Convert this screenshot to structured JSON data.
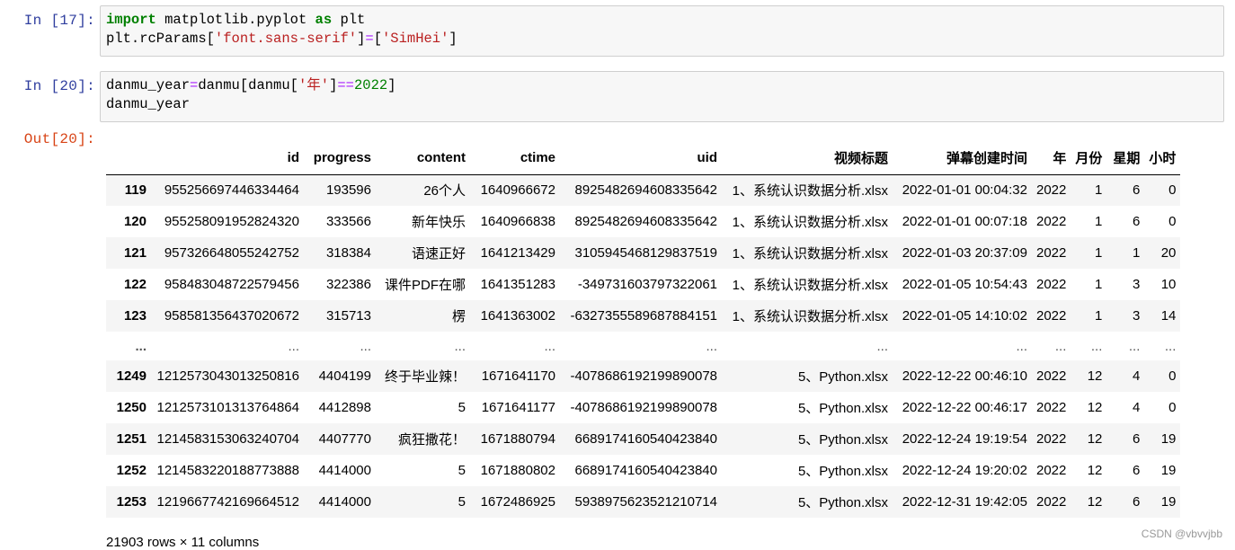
{
  "cells": [
    {
      "prompt": "In  [17]:",
      "lines": [
        [
          {
            "t": "import",
            "c": "kw"
          },
          {
            "t": " matplotlib.pyplot ",
            "c": ""
          },
          {
            "t": "as",
            "c": "kw"
          },
          {
            "t": " plt",
            "c": ""
          }
        ],
        [
          {
            "t": "plt.rcParams[",
            "c": ""
          },
          {
            "t": "'font.sans-serif'",
            "c": "str"
          },
          {
            "t": "]",
            "c": ""
          },
          {
            "t": "=",
            "c": "op"
          },
          {
            "t": "[",
            "c": ""
          },
          {
            "t": "'SimHei'",
            "c": "str"
          },
          {
            "t": "]",
            "c": ""
          }
        ]
      ]
    },
    {
      "prompt": "In  [20]:",
      "lines": [
        [
          {
            "t": "danmu_year",
            "c": ""
          },
          {
            "t": "=",
            "c": "op"
          },
          {
            "t": "danmu[danmu[",
            "c": ""
          },
          {
            "t": "'年'",
            "c": "str"
          },
          {
            "t": "]",
            "c": ""
          },
          {
            "t": "==",
            "c": "op"
          },
          {
            "t": "2022",
            "c": "num"
          },
          {
            "t": "]",
            "c": ""
          }
        ],
        [
          {
            "t": "danmu_year",
            "c": ""
          }
        ]
      ]
    }
  ],
  "output": {
    "prompt": "Out[20]:",
    "columns": [
      "",
      "id",
      "progress",
      "content",
      "ctime",
      "uid",
      "视频标题",
      "弹幕创建时间",
      "年",
      "月份",
      "星期",
      "小时"
    ],
    "rows": [
      [
        "119",
        "955256697446334464",
        "193596",
        "26个人",
        "1640966672",
        "8925482694608335642",
        "1、系统认识数据分析.xlsx",
        "2022-01-01 00:04:32",
        "2022",
        "1",
        "6",
        "0"
      ],
      [
        "120",
        "955258091952824320",
        "333566",
        "新年快乐",
        "1640966838",
        "8925482694608335642",
        "1、系统认识数据分析.xlsx",
        "2022-01-01 00:07:18",
        "2022",
        "1",
        "6",
        "0"
      ],
      [
        "121",
        "957326648055242752",
        "318384",
        "语速正好",
        "1641213429",
        "3105945468129837519",
        "1、系统认识数据分析.xlsx",
        "2022-01-03 20:37:09",
        "2022",
        "1",
        "1",
        "20"
      ],
      [
        "122",
        "958483048722579456",
        "322386",
        "课件PDF在哪",
        "1641351283",
        "-349731603797322061",
        "1、系统认识数据分析.xlsx",
        "2022-01-05 10:54:43",
        "2022",
        "1",
        "3",
        "10"
      ],
      [
        "123",
        "958581356437020672",
        "315713",
        "楞",
        "1641363002",
        "-6327355589687884151",
        "1、系统认识数据分析.xlsx",
        "2022-01-05 14:10:02",
        "2022",
        "1",
        "3",
        "14"
      ],
      [
        "...",
        "...",
        "...",
        "...",
        "...",
        "...",
        "...",
        "...",
        "...",
        "...",
        "...",
        "..."
      ],
      [
        "1249",
        "1212573043013250816",
        "4404199",
        "终于毕业辣！",
        "1671641170",
        "-4078686192199890078",
        "5、Python.xlsx",
        "2022-12-22 00:46:10",
        "2022",
        "12",
        "4",
        "0"
      ],
      [
        "1250",
        "1212573101313764864",
        "4412898",
        "5",
        "1671641177",
        "-4078686192199890078",
        "5、Python.xlsx",
        "2022-12-22 00:46:17",
        "2022",
        "12",
        "4",
        "0"
      ],
      [
        "1251",
        "1214583153063240704",
        "4407770",
        "疯狂撒花！",
        "1671880794",
        "6689174160540423840",
        "5、Python.xlsx",
        "2022-12-24 19:19:54",
        "2022",
        "12",
        "6",
        "19"
      ],
      [
        "1252",
        "1214583220188773888",
        "4414000",
        "5",
        "1671880802",
        "6689174160540423840",
        "5、Python.xlsx",
        "2022-12-24 19:20:02",
        "2022",
        "12",
        "6",
        "19"
      ],
      [
        "1253",
        "1219667742169664512",
        "4414000",
        "5",
        "1672486925",
        "5938975623521210714",
        "5、Python.xlsx",
        "2022-12-31 19:42:05",
        "2022",
        "12",
        "6",
        "19"
      ]
    ],
    "dims": "21903 rows × 11 columns"
  },
  "watermark": "CSDN @vbvvjbb"
}
